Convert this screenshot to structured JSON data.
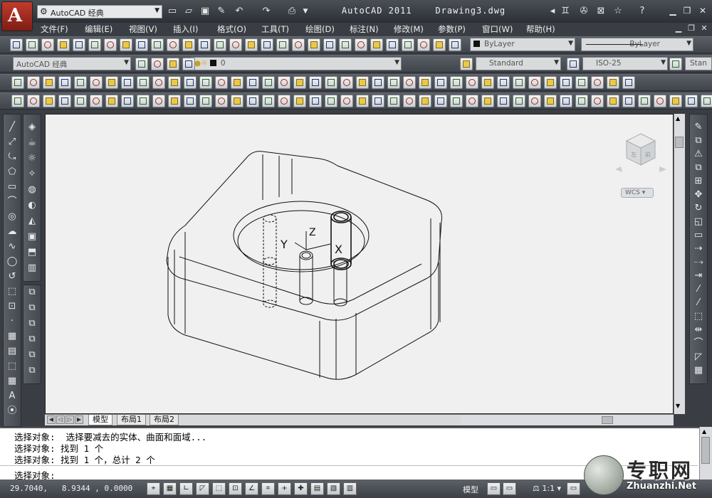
{
  "app": {
    "workspace": "AutoCAD 经典",
    "title": "AutoCAD 2011",
    "filename": "Drawing3.dwg"
  },
  "menu": [
    "文件(F)",
    "编辑(E)",
    "视图(V)",
    "插入(I)",
    "格式(O)",
    "工具(T)",
    "绘图(D)",
    "标注(N)",
    "修改(M)",
    "参数(P)",
    "窗口(W)",
    "帮助(H)"
  ],
  "toolbar": {
    "bylayer_color": "ByLayer",
    "bylayer_linetype": "ByLayer",
    "workspace_combo": "AutoCAD 经典",
    "layer_combo": "0",
    "text_style": "Standard",
    "dim_style": "ISO-25",
    "table_style": "Stan"
  },
  "viewcube": {
    "wcs": "WCS"
  },
  "axes": {
    "y": "Y",
    "z": "Z",
    "x": "X"
  },
  "tabs": [
    "模型",
    "布局1",
    "布局2"
  ],
  "command": {
    "lines": [
      "选择对象:  选择要减去的实体、曲面和面域...",
      "选择对象: 找到 1 个",
      "选择对象: 找到 1 个，总计 2 个"
    ],
    "prompt": "选择对象:"
  },
  "status": {
    "coords": "29.7040,   8.9344 , 0.0000",
    "model": "模型",
    "scale": "1:1"
  },
  "watermark": {
    "cn": "专职网",
    "en": "Zhuanzhi.Net"
  },
  "colors": {
    "accent": "#c43a2c",
    "canvas": "#f0f0f0"
  }
}
